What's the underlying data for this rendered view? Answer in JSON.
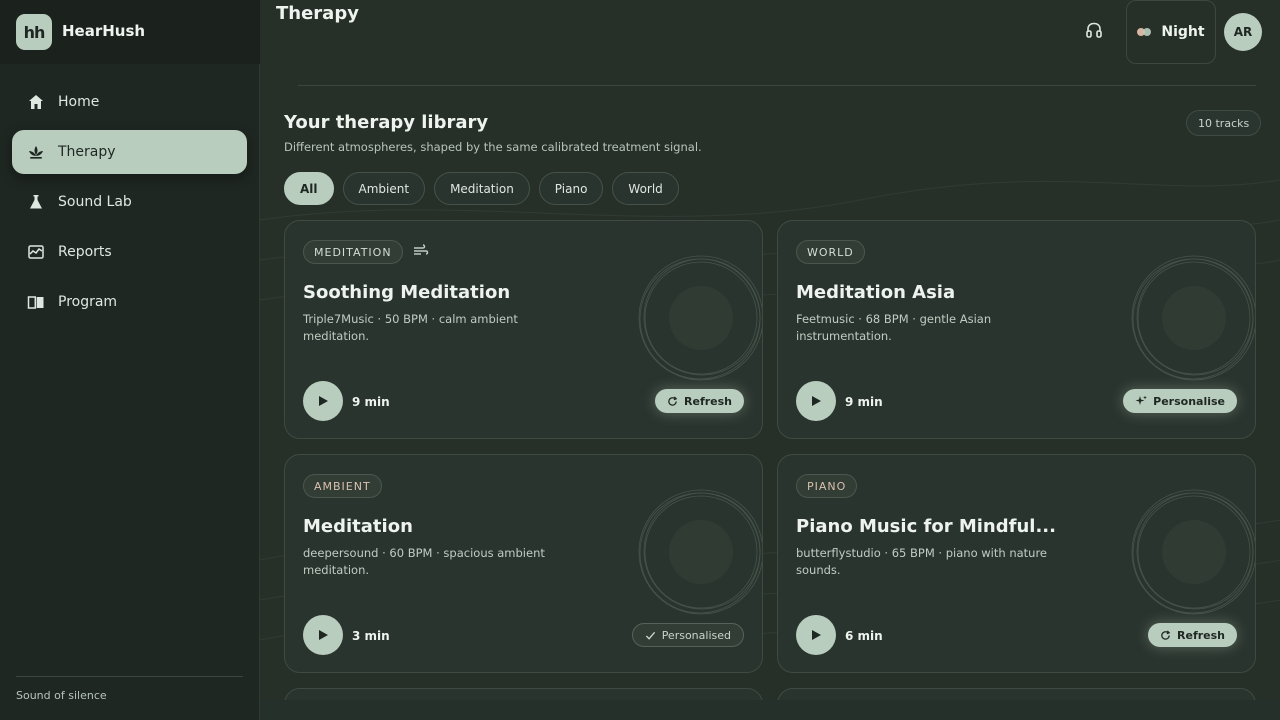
{
  "app": {
    "brand": "HearHush",
    "logo_text": "hh"
  },
  "sidebar": {
    "items": [
      {
        "label": "Home",
        "icon": "home-icon",
        "active": false
      },
      {
        "label": "Therapy",
        "icon": "lotus-icon",
        "active": true
      },
      {
        "label": "Sound Lab",
        "icon": "flask-icon",
        "active": false
      },
      {
        "label": "Reports",
        "icon": "chart-icon",
        "active": false
      },
      {
        "label": "Program",
        "icon": "book-icon",
        "active": false
      }
    ],
    "footer": "Sound of silence"
  },
  "header": {
    "title": "Therapy",
    "theme_label": "Night",
    "avatar_initials": "AR"
  },
  "library": {
    "title": "Your therapy library",
    "subtitle": "Different atmospheres, shaped by the same calibrated treatment signal.",
    "count": "10 tracks",
    "filters": [
      "All",
      "Ambient",
      "Meditation",
      "Piano",
      "World"
    ],
    "active_filter": "All"
  },
  "tracks": [
    {
      "tag": "MEDITATION",
      "title": "Soothing Meditation",
      "desc": "Triple7Music · 50 BPM · calm ambient meditation.",
      "duration": "9 min",
      "action": "Refresh",
      "action_state": "refresh",
      "extra_icon": "wind-icon"
    },
    {
      "tag": "WORLD",
      "title": "Meditation Asia",
      "desc": "Feetmusic · 68 BPM · gentle Asian instrumentation.",
      "duration": "9 min",
      "action": "Personalise",
      "action_state": "personalise"
    },
    {
      "tag": "AMBIENT",
      "title": "Meditation",
      "desc": "deepersound · 60 BPM · spacious ambient meditation.",
      "duration": "3 min",
      "action": "Personalised",
      "action_state": "done"
    },
    {
      "tag": "PIANO",
      "title": "Piano Music for Mindful...",
      "desc": "butterflystudio · 65 BPM · piano with nature sounds.",
      "duration": "6 min",
      "action": "Refresh",
      "action_state": "refresh"
    }
  ],
  "colors": {
    "accent": "#b9cdbf",
    "background": "#263029",
    "sidebar": "#1f2722",
    "warm_tag": "#d9c0ae"
  }
}
